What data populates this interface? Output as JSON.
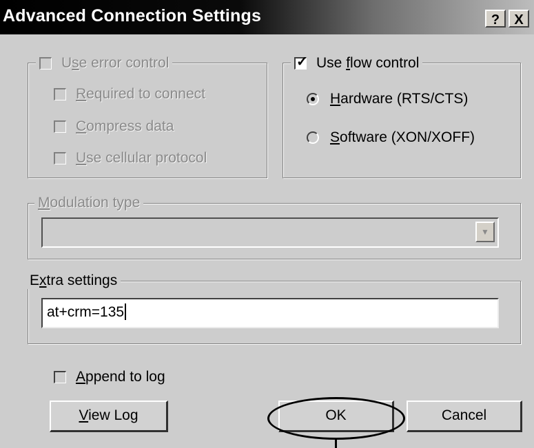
{
  "window": {
    "title": "Advanced Connection Settings",
    "help_button": "?",
    "close_button": "X"
  },
  "error_control": {
    "label": "Use error control",
    "checked": false,
    "enabled": false,
    "options": [
      {
        "label": "Required to connect",
        "checked": false
      },
      {
        "label": "Compress data",
        "checked": false
      },
      {
        "label": "Use cellular protocol",
        "checked": false
      }
    ]
  },
  "flow_control": {
    "label": "Use flow control",
    "checked": true,
    "options": [
      {
        "label": "Hardware (RTS/CTS)",
        "selected": true
      },
      {
        "label": "Software (XON/XOFF)",
        "selected": false
      }
    ]
  },
  "modulation": {
    "label": "Modulation type",
    "value": "",
    "enabled": false
  },
  "extra": {
    "label": "Extra settings",
    "value": "at+crm=135"
  },
  "log": {
    "append_label": "Append to log",
    "append_checked": false,
    "view_button": "View Log"
  },
  "buttons": {
    "ok": "OK",
    "cancel": "Cancel"
  },
  "colors": {
    "title_bar": "#000000",
    "dialog_bg": "#cdcdcd",
    "disabled_text": "#8a8a8a",
    "annotation": "#000000"
  },
  "icons": {
    "check": "check-icon",
    "radio_dot": "radio-dot-icon",
    "dropdown": "chevron-down-icon"
  }
}
